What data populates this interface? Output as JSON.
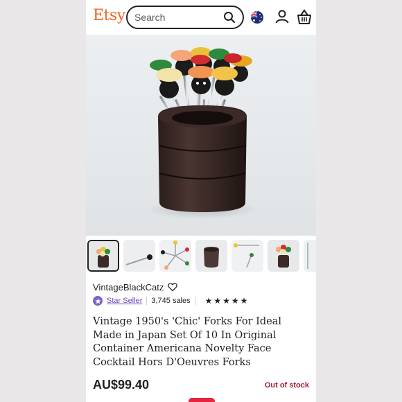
{
  "header": {
    "logo": "Etsy",
    "search_placeholder": "Search",
    "icons": [
      "search-icon",
      "australia-flag-icon",
      "user-icon",
      "basket-icon"
    ]
  },
  "gallery": {
    "thumb_count": 7,
    "selected_index": 0
  },
  "shop": {
    "name": "VintageBlackCatz",
    "badge": "Star Seller",
    "sales": "3,745 sales",
    "rating_stars": 5,
    "rating_display": "★★★★★"
  },
  "listing": {
    "title": "Vintage 1950's 'Chic' Forks For Ideal Made in Japan Set Of 10 In Original Container Americana Novelty Face Cocktail Hors D'Oeuvres Forks",
    "price": "AU$99.40",
    "availability": "Out of stock"
  },
  "colors": {
    "brand": "#f1641e",
    "star_seller": "#7f63c7",
    "out_of_stock": "#a61a2e"
  }
}
